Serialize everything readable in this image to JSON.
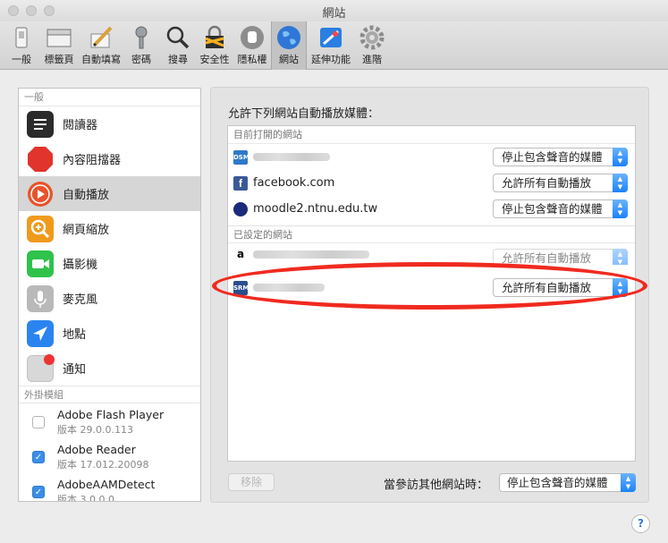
{
  "window": {
    "title": "網站"
  },
  "toolbar": {
    "items": [
      {
        "label": "一般",
        "icon": "general-switch-icon"
      },
      {
        "label": "標籤頁",
        "icon": "tabs-icon"
      },
      {
        "label": "自動填寫",
        "icon": "autofill-pencil-icon"
      },
      {
        "label": "密碼",
        "icon": "key-icon"
      },
      {
        "label": "搜尋",
        "icon": "magnifier-icon"
      },
      {
        "label": "安全性",
        "icon": "lock-icon"
      },
      {
        "label": "隱私權",
        "icon": "hand-icon"
      },
      {
        "label": "網站",
        "icon": "globe-icon",
        "active": true
      },
      {
        "label": "延伸功能",
        "icon": "extensions-icon"
      },
      {
        "label": "進階",
        "icon": "gear-icon"
      }
    ]
  },
  "sidebar": {
    "general_header": "一般",
    "items": [
      {
        "label": "閱讀器",
        "icon": "reader-icon",
        "color": "#2b2b2b"
      },
      {
        "label": "內容阻擋器",
        "icon": "stop-sign-icon",
        "color": "#e0342c"
      },
      {
        "label": "自動播放",
        "icon": "play-icon",
        "color": "#e8532a",
        "selected": true
      },
      {
        "label": "網頁縮放",
        "icon": "zoom-icon",
        "color": "#f09a1c"
      },
      {
        "label": "攝影機",
        "icon": "camera-icon",
        "color": "#2fc24b"
      },
      {
        "label": "麥克風",
        "icon": "microphone-icon",
        "color": "#b9b9b9"
      },
      {
        "label": "地點",
        "icon": "location-arrow-icon",
        "color": "#2a84f0"
      },
      {
        "label": "通知",
        "icon": "notification-icon",
        "color": "#d8d8d8"
      }
    ],
    "plugins_header": "外掛模組",
    "plugins": [
      {
        "name": "Adobe Flash Player",
        "version": "版本 29.0.0.113",
        "checked": false
      },
      {
        "name": "Adobe Reader",
        "version": "版本 17.012.20098",
        "checked": true
      },
      {
        "name": "AdobeAAMDetect",
        "version": "版本 3.0.0.0",
        "checked": true
      }
    ]
  },
  "main": {
    "heading": "允許下列網站自動播放媒體：",
    "open_group_label": "目前打開的網站",
    "configured_group_label": "已設定的網站",
    "open_sites": [
      {
        "name": "",
        "favicon": "DSM",
        "fav_color": "#2f79c9",
        "setting": "停止包含聲音的媒體"
      },
      {
        "name": "facebook.com",
        "favicon": "f",
        "fav_color": "#3b5998",
        "setting": "允許所有自動播放"
      },
      {
        "name": "moodle2.ntnu.edu.tw",
        "favicon": "",
        "fav_color": "#1b2a7a",
        "setting": "停止包含聲音的媒體"
      }
    ],
    "configured_sites": [
      {
        "name": "",
        "favicon": "a",
        "fav_color": "#ffffff",
        "setting": "允許所有自動播放"
      },
      {
        "name": "",
        "favicon": "SRM",
        "fav_color": "#2a4f8c",
        "setting": "允許所有自動播放"
      }
    ],
    "remove_label": "移除",
    "other_sites_label": "當參訪其他網站時：",
    "other_sites_setting": "停止包含聲音的媒體",
    "highlight_color": "#f02a1f"
  },
  "help": {
    "label": "?"
  }
}
